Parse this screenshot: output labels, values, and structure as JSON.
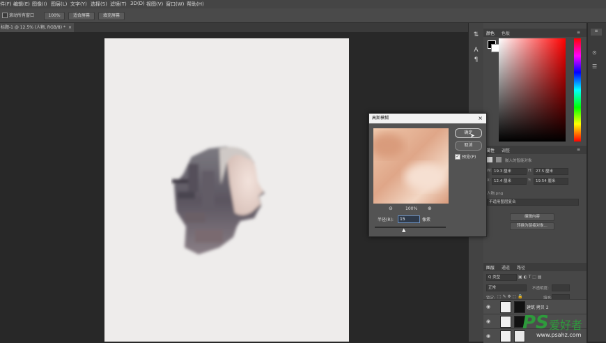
{
  "menubar": {
    "items": [
      "件(F)",
      "编辑(E)",
      "图像(I)",
      "图层(L)",
      "文字(Y)",
      "选择(S)",
      "滤镜(T)",
      "3D(D)",
      "视图(V)",
      "窗口(W)",
      "帮助(H)"
    ]
  },
  "options": {
    "scroll_all_label": "滚动所有窗口",
    "zoom_btn": "100%",
    "fit_screen_btn": "适合屏幕",
    "fill_screen_btn": "填充屏幕"
  },
  "document": {
    "tab_label": "标题-1 @ 12.5% (人物, RGB/8) *",
    "close": "×"
  },
  "color_panel": {
    "tabs": [
      "颜色",
      "色板"
    ]
  },
  "properties_panel": {
    "tabs": [
      "属性",
      "调整"
    ],
    "embed_label": "嵌入的智能对象",
    "w_label": "W:",
    "w_value": "19.3 厘米",
    "h_label": "H:",
    "h_value": "27.5 厘米",
    "x_label": "X:",
    "x_value": "12.4 厘米",
    "y_label": "Y:",
    "y_value": "19.54 厘米",
    "file_name": "人物.png",
    "comp_label": "不适用图层复合",
    "edit_contents_btn": "编辑内容",
    "convert_btn": "转换为链接对象..."
  },
  "layers_panel": {
    "tabs": [
      "图层",
      "通道",
      "路径"
    ],
    "kind_label": "Q 类型",
    "blend_mode": "正常",
    "opacity_label": "不透明度:",
    "lock_label": "锁定:",
    "fill_label": "填充:",
    "layer1_name": "建筑 拷贝 2"
  },
  "dialog": {
    "title": "高斯模糊",
    "ok_label": "确定",
    "cancel_label": "取消",
    "preview_label": "预览(P)",
    "preview_checked": true,
    "zoom_out": "⊖",
    "zoom_level": "100%",
    "zoom_in": "⊕",
    "radius_label": "半径(R):",
    "radius_value": "15",
    "radius_unit": "像素",
    "close": "×"
  },
  "watermark": {
    "logo_text": "PS",
    "logo_suffix": "爱好者",
    "url": "www.psahz.com"
  },
  "colors": {
    "ui_dark": "#282828",
    "panel": "#474747",
    "artboard": "#eeeceb",
    "picker_red": "#ff0000"
  }
}
